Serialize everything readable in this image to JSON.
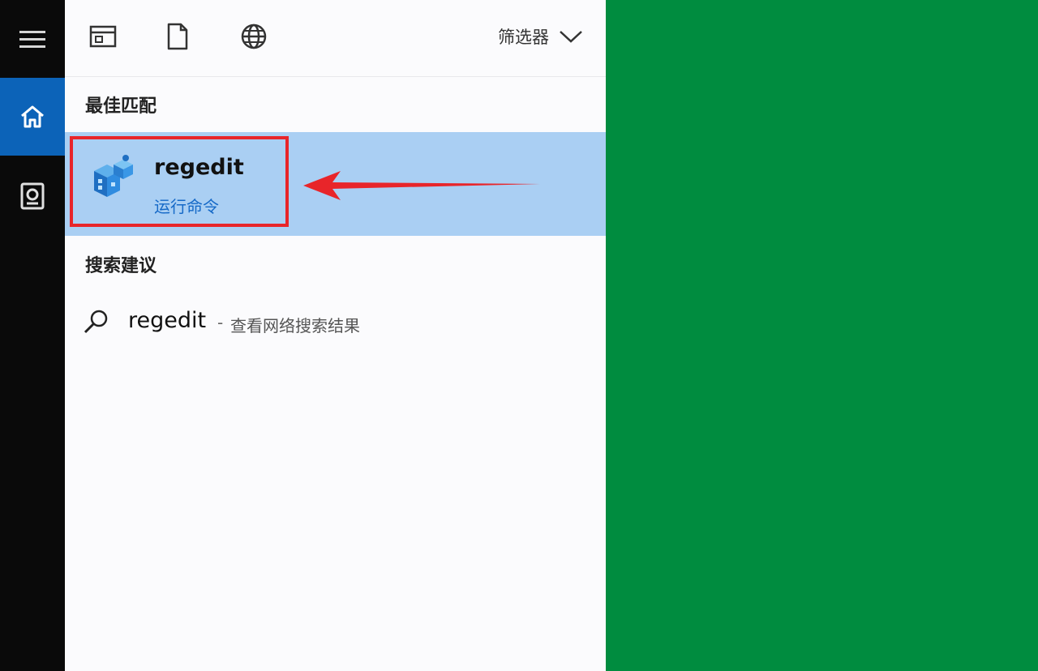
{
  "rail": {
    "icons": [
      "hamburger-menu-icon",
      "home-icon",
      "notebook-icon"
    ]
  },
  "toolbar": {
    "icons": [
      "apps-window-icon",
      "document-icon",
      "globe-icon"
    ],
    "filter_label": "筛选器"
  },
  "best_match": {
    "section_title": "最佳匹配",
    "app_name": "regedit",
    "app_subtitle": "运行命令"
  },
  "suggestions": {
    "section_title": "搜索建议",
    "items": [
      {
        "query": "regedit",
        "separator": "-",
        "hint": "查看网络搜索结果"
      }
    ]
  },
  "colors": {
    "rail_bg": "#0a0a0a",
    "rail_active": "#0c63b8",
    "selection_bg": "#aacff3",
    "annotation_red": "#e8252a",
    "link_blue": "#1569c7",
    "desktop_green": "#008c3f"
  }
}
